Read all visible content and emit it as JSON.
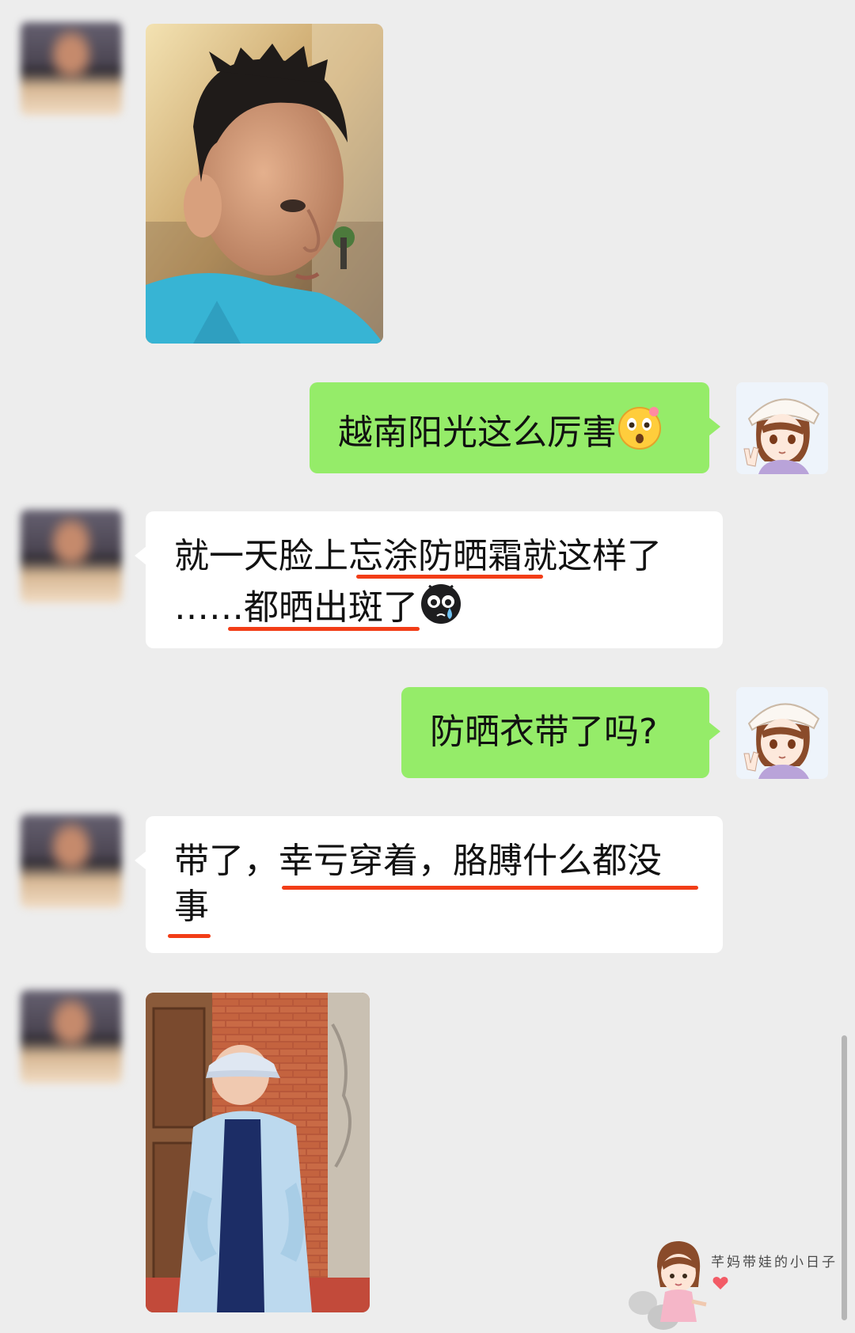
{
  "messages": [
    {
      "side": "left",
      "type": "image",
      "alt": ""
    },
    {
      "side": "right",
      "type": "text",
      "text": "越南阳光这么厉害",
      "emoji": "astonished-face"
    },
    {
      "side": "left",
      "type": "text",
      "line1": "就一天脸上忘涂防晒霜就这样了",
      "line2": "……都晒出斑了",
      "emoji": "crying-face"
    },
    {
      "side": "right",
      "type": "text",
      "text": "防晒衣带了吗?"
    },
    {
      "side": "left",
      "type": "text",
      "line1": "带了，幸亏穿着，胳膊什么都没",
      "line2": "事"
    },
    {
      "side": "left",
      "type": "image",
      "alt": ""
    }
  ],
  "watermark": {
    "text": "芊妈带娃的小日子"
  },
  "colors": {
    "background": "#ededed",
    "sent_bubble": "#95ec69",
    "received_bubble": "#ffffff",
    "underline": "#f23d17"
  },
  "icons": [
    "astonished-face",
    "crying-face",
    "heart-icon",
    "wechat-icon"
  ]
}
